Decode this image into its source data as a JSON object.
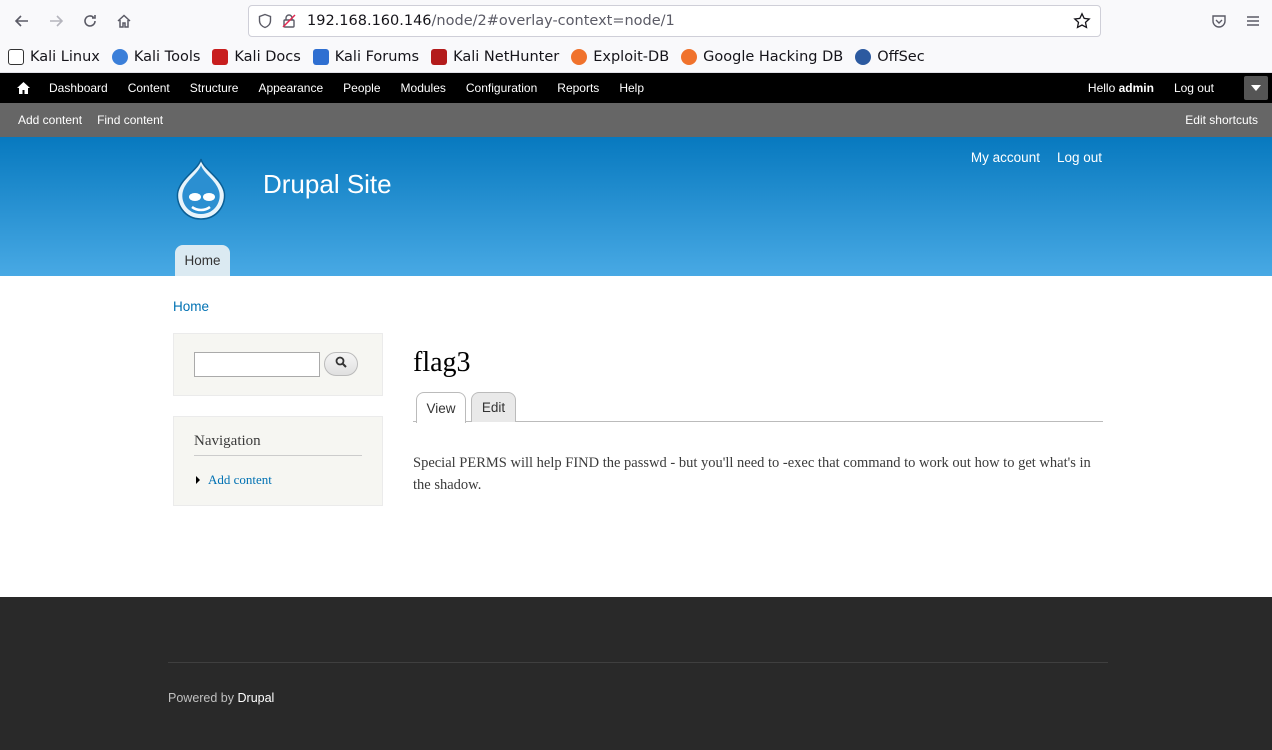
{
  "browser": {
    "url_host": "192.168.160.146",
    "url_path": "/node/2#overlay-context=node/1",
    "bookmarks": [
      "Kali Linux",
      "Kali Tools",
      "Kali Docs",
      "Kali Forums",
      "Kali NetHunter",
      "Exploit-DB",
      "Google Hacking DB",
      "OffSec"
    ]
  },
  "toolbar": {
    "items": [
      "Dashboard",
      "Content",
      "Structure",
      "Appearance",
      "People",
      "Modules",
      "Configuration",
      "Reports",
      "Help"
    ],
    "hello": "Hello",
    "user": "admin",
    "logout": "Log out"
  },
  "shortcuts": {
    "items": [
      "Add content",
      "Find content"
    ],
    "edit": "Edit shortcuts"
  },
  "header": {
    "site_name": "Drupal Site",
    "my_account": "My account",
    "logout": "Log out",
    "main_tab": "Home",
    "gradient_top": "#0779bf",
    "gradient_bottom": "#48a9e4"
  },
  "content": {
    "breadcrumb": "Home",
    "nav_title": "Navigation",
    "nav_link": "Add content",
    "title": "flag3",
    "tab_view": "View",
    "tab_edit": "Edit",
    "body": "Special PERMS will help FIND the passwd - but you'll need to -exec that command to work out how to get what's in the shadow."
  },
  "footer": {
    "powered_prefix": "Powered by",
    "powered_link": "Drupal"
  }
}
